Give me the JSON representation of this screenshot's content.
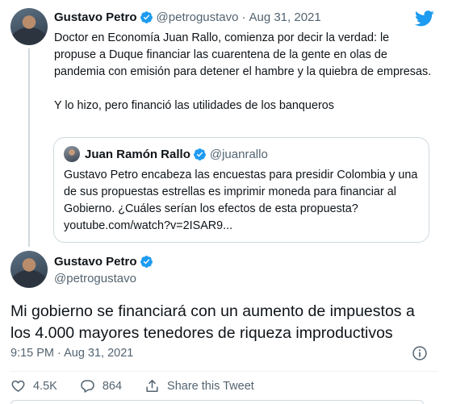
{
  "parent_tweet": {
    "author_name": "Gustavo Petro",
    "handle": "@petrogustavo",
    "separator": "·",
    "date": "Aug 31, 2021",
    "text_para1": "Doctor en Economía Juan Rallo, comienza por decir la verdad: le propuse a Duque financiar las cuarentena de la gente en olas de pandemia con emisión para detener el hambre y la quiebra de empresas.",
    "text_para2": "Y lo hizo, pero financió las utilidades de los banqueros"
  },
  "quoted_tweet": {
    "author_name": "Juan Ramón Rallo",
    "handle": "@juanrallo",
    "text": "Gustavo Petro encabeza las encuestas para presidir Colombia y una de sus propuestas estrellas es imprimir moneda para financiar al Gobierno. ¿Cuáles serían los efectos de esta propuesta? youtube.com/watch?v=2ISAR9..."
  },
  "main_tweet": {
    "author_name": "Gustavo Petro",
    "handle": "@petrogustavo",
    "text": "Mi gobierno se financiará con un aumento de impuestos a los 4.000 mayores tenedores de riqueza improductivos",
    "timestamp": "9:15 PM · Aug 31, 2021"
  },
  "actions": {
    "likes": "4.5K",
    "replies": "864",
    "share_label": "Share this Tweet"
  },
  "colors": {
    "verified_blue": "#1d9bf0",
    "twitter_blue": "#1d9bf0",
    "muted_text": "#536471",
    "border": "#cfd9de"
  },
  "icons": [
    "twitter-bird-icon",
    "verified-badge-icon",
    "info-icon",
    "heart-icon",
    "reply-icon",
    "share-icon"
  ]
}
